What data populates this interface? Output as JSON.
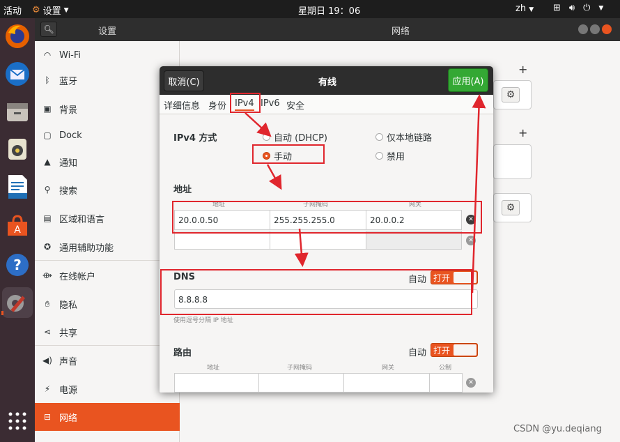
{
  "topbar": {
    "activities": "活动",
    "app_name": "设置",
    "clock": "星期日 19：06",
    "lang": "zh"
  },
  "header": {
    "left_title": "设置",
    "right_title": "网络"
  },
  "sidebar": {
    "items": [
      {
        "label": "Wi-Fi",
        "icon": "wifi-icon"
      },
      {
        "label": "蓝牙",
        "icon": "bluetooth-icon"
      },
      {
        "label": "背景",
        "icon": "background-icon"
      },
      {
        "label": "Dock",
        "icon": "dock-icon"
      },
      {
        "label": "通知",
        "icon": "bell-icon"
      },
      {
        "label": "搜索",
        "icon": "search-icon"
      },
      {
        "label": "区域和语言",
        "icon": "region-icon"
      },
      {
        "label": "通用辅助功能",
        "icon": "accessibility-icon"
      },
      {
        "label": "在线帐户",
        "icon": "online-accounts-icon"
      },
      {
        "label": "隐私",
        "icon": "hand-icon"
      },
      {
        "label": "共享",
        "icon": "share-icon"
      },
      {
        "label": "声音",
        "icon": "speaker-icon"
      },
      {
        "label": "电源",
        "icon": "power-icon"
      },
      {
        "label": "网络",
        "icon": "network-icon"
      }
    ],
    "selected": "网络"
  },
  "dialog": {
    "title": "有线",
    "cancel": "取消(C)",
    "apply": "应用(A)",
    "tabs": [
      "详细信息",
      "身份",
      "IPv4",
      "IPv6",
      "安全"
    ],
    "method_label": "IPv4 方式",
    "methods": {
      "auto": "自动 (DHCP)",
      "link_local": "仅本地链路",
      "manual": "手动",
      "disable": "禁用"
    },
    "address_title": "地址",
    "address_cols": [
      "地址",
      "子网掩码",
      "网关"
    ],
    "address_row": {
      "address": "20.0.0.50",
      "netmask": "255.255.255.0",
      "gateway": "20.0.0.2"
    },
    "dns_title": "DNS",
    "dns_auto": "自动",
    "dns_toggle": "打开",
    "dns_value": "8.8.8.8",
    "dns_hint": "使用逗号分隔 IP 地址",
    "route_title": "路由",
    "route_auto": "自动",
    "route_toggle": "打开",
    "route_cols": [
      "地址",
      "子网掩码",
      "网关",
      "公制"
    ]
  },
  "accent": "#e95420",
  "apply_color": "#34a834",
  "watermark": "CSDN @yu.deqiang"
}
